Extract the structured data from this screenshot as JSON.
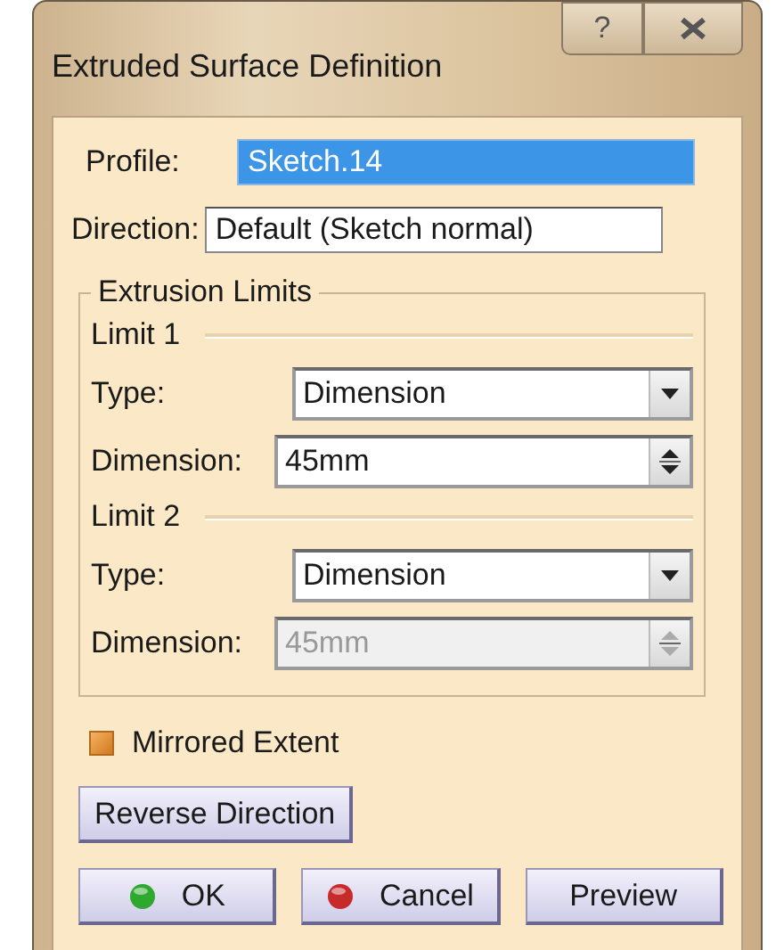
{
  "window": {
    "title": "Extruded Surface Definition",
    "help_button": "?"
  },
  "profile": {
    "label": "Profile:",
    "value": "Sketch.14",
    "selected": true
  },
  "direction": {
    "label": "Direction:",
    "value": "Default (Sketch normal)",
    "selected": false
  },
  "extrusion_limits": {
    "title": "Extrusion Limits",
    "limits": [
      {
        "title": "Limit 1",
        "type_label": "Type:",
        "type_value": "Dimension",
        "dimension_label": "Dimension:",
        "dimension_value": "45mm",
        "disabled": false
      },
      {
        "title": "Limit 2",
        "type_label": "Type:",
        "type_value": "Dimension",
        "dimension_label": "Dimension:",
        "dimension_value": "45mm",
        "disabled": true
      }
    ]
  },
  "mirrored_extent": {
    "label": "Mirrored Extent",
    "checked": true
  },
  "reverse_button": "Reverse Direction",
  "buttons": [
    {
      "label": "OK",
      "kind": "ok"
    },
    {
      "label": "Cancel",
      "kind": "cancel"
    },
    {
      "label": "Preview",
      "kind": "plain"
    }
  ]
}
